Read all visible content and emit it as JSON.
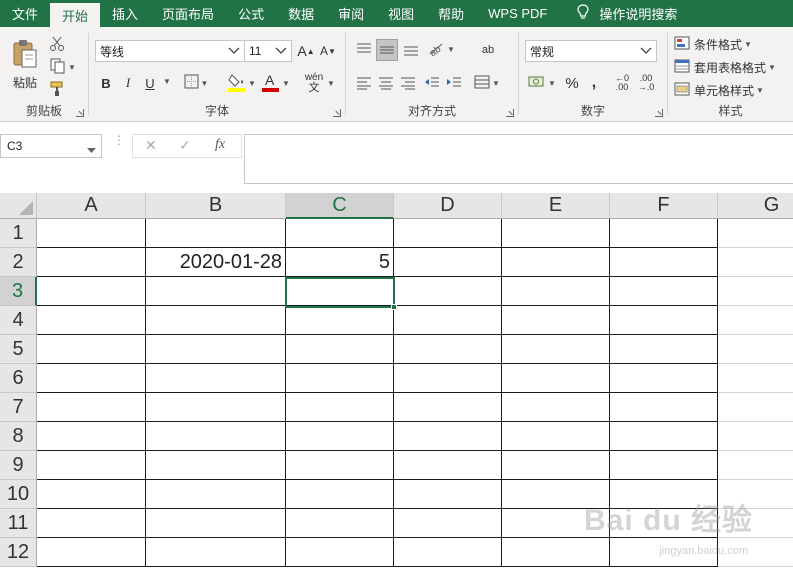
{
  "menu": {
    "items": [
      "文件",
      "开始",
      "插入",
      "页面布局",
      "公式",
      "数据",
      "审阅",
      "视图",
      "帮助",
      "WPS PDF"
    ],
    "active_index": 1,
    "tell_me": "操作说明搜索"
  },
  "ribbon": {
    "clipboard": {
      "paste_label": "粘贴",
      "group_label": "剪贴板"
    },
    "font": {
      "font_name": "等线",
      "font_size": "11",
      "bold": "B",
      "italic": "I",
      "underline": "U",
      "group_label": "字体",
      "phonetic": "wén",
      "font_color": "#d00000",
      "fill_color": "#ffff00"
    },
    "alignment": {
      "group_label": "对齐方式",
      "wrap": "ab"
    },
    "number": {
      "format": "常规",
      "percent": "%",
      "comma": ",",
      "group_label": "数字"
    },
    "styles": {
      "conditional": "条件格式",
      "table_format": "套用表格格式",
      "cell_styles": "单元格样式",
      "group_label": "样式"
    }
  },
  "formula_bar": {
    "name_box": "C3",
    "fx": "fx",
    "value": ""
  },
  "grid": {
    "columns": [
      "A",
      "B",
      "C",
      "D",
      "E",
      "F",
      "G"
    ],
    "rows": [
      "1",
      "2",
      "3",
      "4",
      "5",
      "6",
      "7",
      "8",
      "9",
      "10",
      "11",
      "12"
    ],
    "selected_cell": "C3",
    "cells": {
      "B2": "2020-01-28",
      "C2": "5"
    }
  },
  "watermark": {
    "text": "Bai du 经验",
    "sub": "jingyan.baidu.com"
  },
  "colors": {
    "accent": "#217346"
  }
}
